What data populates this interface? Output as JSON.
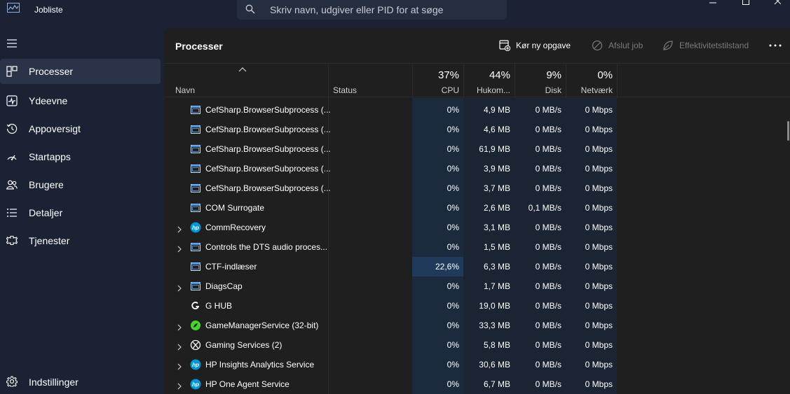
{
  "window": {
    "title": "Jobliste",
    "search_placeholder": "Skriv navn, udgiver eller PID for at søge"
  },
  "sidebar": {
    "items": [
      {
        "label": "Processer",
        "icon": "processes-icon",
        "active": true
      },
      {
        "label": "Ydeevne",
        "icon": "performance-icon"
      },
      {
        "label": "Appoversigt",
        "icon": "app-history-icon"
      },
      {
        "label": "Startapps",
        "icon": "startup-apps-icon"
      },
      {
        "label": "Brugere",
        "icon": "users-icon"
      },
      {
        "label": "Detaljer",
        "icon": "details-icon"
      },
      {
        "label": "Tjenester",
        "icon": "services-icon"
      }
    ],
    "settings_label": "Indstillinger"
  },
  "toolbar": {
    "title": "Processer",
    "run_task": "Kør ny opgave",
    "end_task": "Afslut job",
    "efficiency": "Effektivitetstilstand"
  },
  "columns": {
    "name": "Navn",
    "status": "Status",
    "cpu": {
      "pct": "37%",
      "label": "CPU"
    },
    "memory": {
      "pct": "44%",
      "label": "Hukom..."
    },
    "disk": {
      "pct": "9%",
      "label": "Disk"
    },
    "network": {
      "pct": "0%",
      "label": "Netværk"
    }
  },
  "rows": [
    {
      "name": "CefSharp.BrowserSubprocess (...",
      "cpu": "0%",
      "mem": "4,9 MB",
      "disk": "0 MB/s",
      "net": "0 Mbps",
      "expand": false,
      "icon": "app-window-icon"
    },
    {
      "name": "CefSharp.BrowserSubprocess (...",
      "cpu": "0%",
      "mem": "4,6 MB",
      "disk": "0 MB/s",
      "net": "0 Mbps",
      "expand": false,
      "icon": "app-window-icon"
    },
    {
      "name": "CefSharp.BrowserSubprocess (...",
      "cpu": "0%",
      "mem": "61,9 MB",
      "disk": "0 MB/s",
      "net": "0 Mbps",
      "expand": false,
      "icon": "app-window-icon"
    },
    {
      "name": "CefSharp.BrowserSubprocess (...",
      "cpu": "0%",
      "mem": "3,9 MB",
      "disk": "0 MB/s",
      "net": "0 Mbps",
      "expand": false,
      "icon": "app-window-icon"
    },
    {
      "name": "CefSharp.BrowserSubprocess (...",
      "cpu": "0%",
      "mem": "3,7 MB",
      "disk": "0 MB/s",
      "net": "0 Mbps",
      "expand": false,
      "icon": "app-window-icon"
    },
    {
      "name": "COM Surrogate",
      "cpu": "0%",
      "mem": "2,6 MB",
      "disk": "0,1 MB/s",
      "net": "0 Mbps",
      "expand": false,
      "icon": "app-window-icon"
    },
    {
      "name": "CommRecovery",
      "cpu": "0%",
      "mem": "3,1 MB",
      "disk": "0 MB/s",
      "net": "0 Mbps",
      "expand": true,
      "icon": "hp-logo-icon"
    },
    {
      "name": "Controls the DTS audio proces...",
      "cpu": "0%",
      "mem": "1,5 MB",
      "disk": "0 MB/s",
      "net": "0 Mbps",
      "expand": true,
      "icon": "app-window-icon"
    },
    {
      "name": "CTF-indlæser",
      "cpu": "22,6%",
      "mem": "6,3 MB",
      "disk": "0 MB/s",
      "net": "0 Mbps",
      "expand": false,
      "icon": "app-window-icon",
      "cpu_high": true
    },
    {
      "name": "DiagsCap",
      "cpu": "0%",
      "mem": "1,7 MB",
      "disk": "0 MB/s",
      "net": "0 Mbps",
      "expand": true,
      "icon": "app-window-icon"
    },
    {
      "name": "G HUB",
      "cpu": "0%",
      "mem": "19,0 MB",
      "disk": "0 MB/s",
      "net": "0 Mbps",
      "expand": false,
      "icon": "logitech-g-icon"
    },
    {
      "name": "GameManagerService (32-bit)",
      "cpu": "0%",
      "mem": "33,3 MB",
      "disk": "0 MB/s",
      "net": "0 Mbps",
      "expand": true,
      "icon": "razer-icon"
    },
    {
      "name": "Gaming Services (2)",
      "cpu": "0%",
      "mem": "5,8 MB",
      "disk": "0 MB/s",
      "net": "0 Mbps",
      "expand": true,
      "icon": "xbox-icon"
    },
    {
      "name": "HP Insights Analytics Service",
      "cpu": "0%",
      "mem": "30,6 MB",
      "disk": "0 MB/s",
      "net": "0 Mbps",
      "expand": true,
      "icon": "hp-logo-icon"
    },
    {
      "name": "HP One Agent Service",
      "cpu": "0%",
      "mem": "6,7 MB",
      "disk": "0 MB/s",
      "net": "0 Mbps",
      "expand": true,
      "icon": "hp-logo-icon"
    }
  ],
  "colors": {
    "sidebar_bg": "#1a2234",
    "panel_bg": "#1f1f1f",
    "cpu_highlight": "#203a5c",
    "accent": "#4cc2ff"
  }
}
